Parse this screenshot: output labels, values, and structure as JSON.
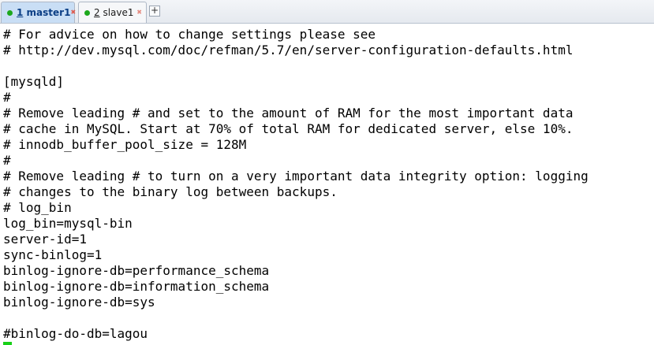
{
  "tabs": [
    {
      "num": "1",
      "name": " master1",
      "status_color": "#1ca81c",
      "active": true
    },
    {
      "num": "2",
      "name": " slave1",
      "status_color": "#1ca81c",
      "active": false
    }
  ],
  "tab_close_glyph": "✖",
  "add_tab_glyph": "+",
  "terminal": {
    "lines": [
      "# For advice on how to change settings please see",
      "# http://dev.mysql.com/doc/refman/5.7/en/server-configuration-defaults.html",
      "",
      "[mysqld]",
      "#",
      "# Remove leading # and set to the amount of RAM for the most important data",
      "# cache in MySQL. Start at 70% of total RAM for dedicated server, else 10%.",
      "# innodb_buffer_pool_size = 128M",
      "#",
      "# Remove leading # to turn on a very important data integrity option: logging",
      "# changes to the binary log between backups.",
      "# log_bin",
      "log_bin=mysql-bin",
      "server-id=1",
      "sync-binlog=1",
      "binlog-ignore-db=performance_schema",
      "binlog-ignore-db=information_schema",
      "binlog-ignore-db=sys",
      "",
      "#binlog-do-db=lagou"
    ],
    "cursor_color": "#18d018"
  }
}
